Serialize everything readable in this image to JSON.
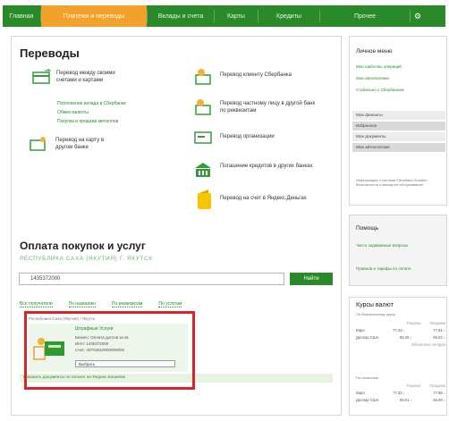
{
  "nav": {
    "tabs": [
      {
        "label": "Главная",
        "active": false
      },
      {
        "label": "Платежи и переводы",
        "active": true
      },
      {
        "label": "Вклады и счета",
        "active": false
      },
      {
        "label": "Карты",
        "active": false
      },
      {
        "label": "Кредиты",
        "active": false
      },
      {
        "label": "Прочее",
        "active": false
      }
    ],
    "settings_icon": "gear-icon"
  },
  "transfers": {
    "title": "Переводы",
    "items": [
      {
        "label": "Перевод между своими счетами и картами",
        "icon": "own-accounts-icon"
      },
      {
        "label": "Перевод клиенту Сбербанка",
        "icon": "client-transfer-icon"
      },
      {
        "label": "Перевод частному лицу в другой банк по реквизитам",
        "icon": "other-bank-icon"
      },
      {
        "label": "Перевод организации",
        "icon": "organization-icon"
      },
      {
        "label": "Погашение кредитов в других банках",
        "icon": "bank-building-icon"
      },
      {
        "label": "Перевод на счет в Яндекс.Деньгах",
        "icon": "yandex-wallet-icon"
      },
      {
        "label": "Перевод на карту в другом банке",
        "icon": "card-transfer-icon"
      }
    ],
    "links": [
      "Пополнение вклада в Сбербанке",
      "Обмен валюты",
      "Покупка и продажа металлов"
    ]
  },
  "payments": {
    "title": "Оплата покупок и услуг",
    "region": "РЕСПУБЛИКА САХА (ЯКУТИЯ) Г. ЯКУТСК",
    "search_value": "1435372000",
    "search_button": "Найти",
    "filters": [
      "Все получатели",
      "По названию",
      "По реквизитам",
      "По услугам"
    ],
    "result": {
      "header": "Республика Саха (Якутия) / Якутск",
      "title": "Штрафные Услуги",
      "lines": [
        "Бизнес: Оплата долгов за кв.",
        "ИНН: 1435372000",
        "Счет: 40702810000000000"
      ],
      "select_label": "Выбрать",
      "icon": "payment-recipient-icon"
    },
    "footer_link": "Показать документы по оплате на Яндекс.Кошелек"
  },
  "sidebar": {
    "personal": {
      "title": "Личное меню",
      "links": [
        "Мои шаблоны операций",
        "Мои автоплатежи",
        "Стабильно с Сбербанком"
      ],
      "rows": [
        "Мои финансы",
        "Избранное",
        "Мои документы",
        "Мои автоплатежи"
      ],
      "info": "Информация о системе Сбербанк Онлайн: безопасность и выгодное обслуживание"
    },
    "help": {
      "title": "Помощь",
      "links": [
        "Часто задаваемые вопросы",
        "Правила и тарифы по оплате"
      ]
    },
    "rates": {
      "title": "Курсы валют",
      "sub1": "По безналичному курсу",
      "headers": [
        "Покупка",
        "Продажа"
      ],
      "rows1": [
        {
          "name": "Евро",
          "buy": "77.33 ↓",
          "sell": "77.61 ↓"
        },
        {
          "name": "Доллар США",
          "buy": "65.26 ↓",
          "sell": "66.04 ↓"
        }
      ],
      "note": "Обновлено сегодня",
      "sub2": "По наличным",
      "rows2": [
        {
          "name": "Евро",
          "buy": "77.33 ↓",
          "sell": "77.88 ↓"
        },
        {
          "name": "Доллар США",
          "buy": "65.01 ↓",
          "sell": "66.09 ↓"
        }
      ]
    }
  }
}
